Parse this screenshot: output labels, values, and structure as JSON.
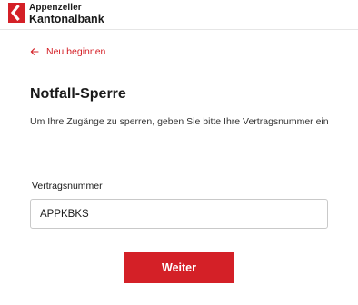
{
  "brand": {
    "name_line1": "Appenzeller",
    "name_line2": "Kantonalbank",
    "accent_color": "#d42027",
    "logo_icon": "bank-logo-mark"
  },
  "nav": {
    "back_label": "Neu beginnen",
    "back_icon": "arrow-left-icon"
  },
  "main": {
    "title": "Notfall-Sperre",
    "description": "Um Ihre Zugänge zu sperren, geben Sie bitte Ihre Vertragsnummer ein"
  },
  "form": {
    "contract_label": "Vertragsnummer",
    "contract_value": "APPKBKS",
    "submit_label": "Weiter"
  }
}
